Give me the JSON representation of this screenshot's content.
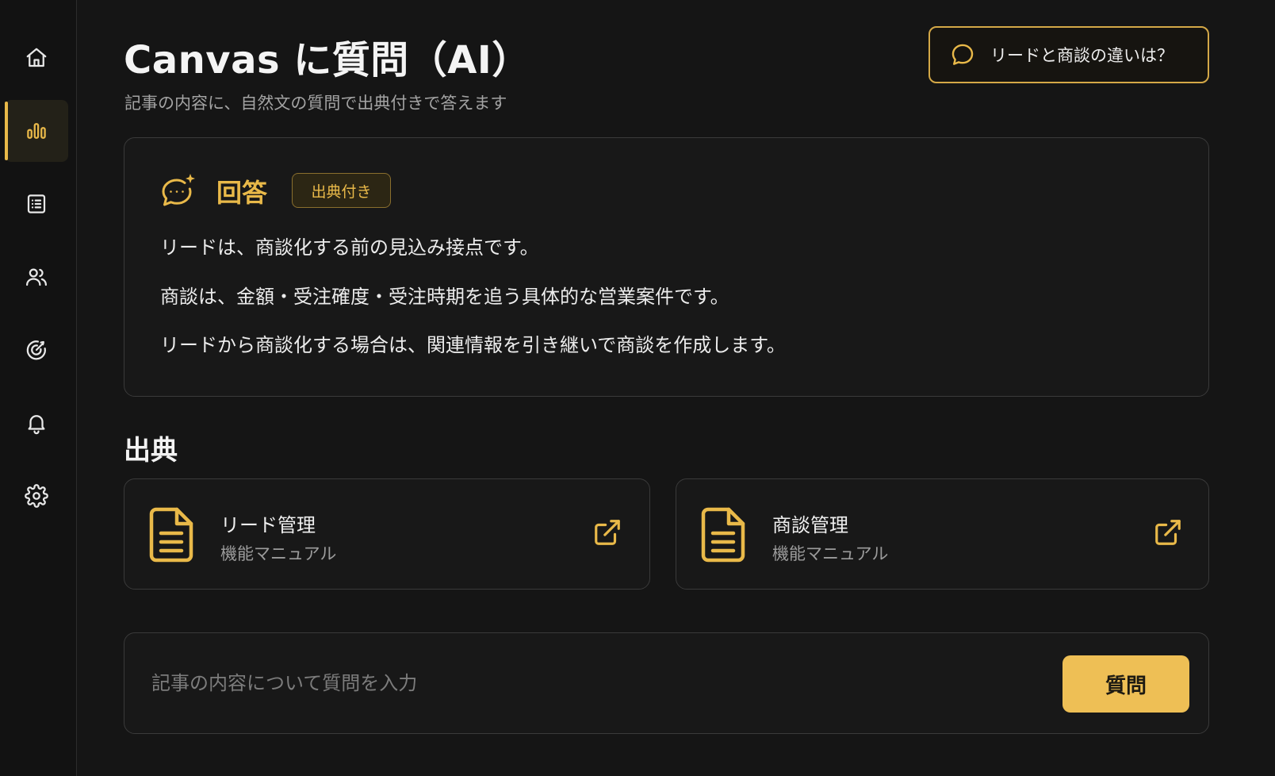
{
  "colors": {
    "accent": "#e9b949",
    "background": "#151515",
    "card": "#181818",
    "border": "#3a3a3a",
    "button": "#eebf55"
  },
  "sidebar": {
    "items": [
      {
        "name": "home",
        "icon": "home-icon",
        "active": false
      },
      {
        "name": "analytics",
        "icon": "bar-chart-icon",
        "active": true
      },
      {
        "name": "list",
        "icon": "list-icon",
        "active": false
      },
      {
        "name": "users",
        "icon": "users-icon",
        "active": false
      },
      {
        "name": "goals",
        "icon": "target-icon",
        "active": false
      },
      {
        "name": "notifications",
        "icon": "bell-icon",
        "active": false
      },
      {
        "name": "settings",
        "icon": "gear-icon",
        "active": false
      }
    ]
  },
  "header": {
    "title": "Canvas に質問（AI）",
    "subtitle": "記事の内容に、自然文の質問で出典付きで答えます",
    "suggestion": "リードと商談の違いは？"
  },
  "answer": {
    "title": "回答",
    "badge": "出典付き",
    "lines": [
      "リードは、商談化する前の見込み接点です。",
      "商談は、金額・受注確度・受注時期を追う具体的な営業案件です。",
      "リードから商談化する場合は、関連情報を引き継いで商談を作成します。"
    ]
  },
  "sources": {
    "heading": "出典",
    "items": [
      {
        "title": "リード管理",
        "subtitle": "機能マニュアル"
      },
      {
        "title": "商談管理",
        "subtitle": "機能マニュアル"
      }
    ]
  },
  "input": {
    "placeholder": "記事の内容について質問を入力",
    "value": "",
    "submit_label": "質問"
  }
}
